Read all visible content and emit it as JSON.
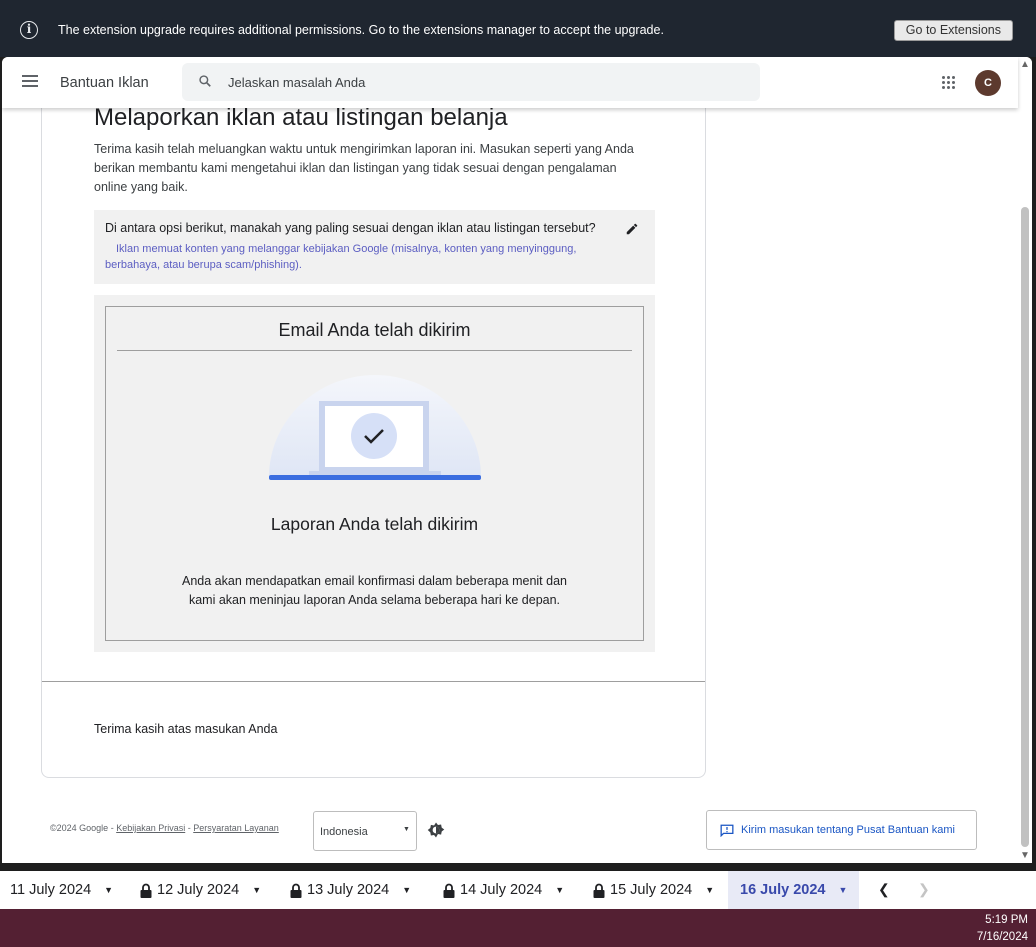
{
  "banner": {
    "message": "The extension upgrade requires additional permissions. Go to the extensions manager to accept the upgrade.",
    "button_label": "Go to Extensions"
  },
  "appbar": {
    "brand": "Bantuan Iklan",
    "search_placeholder": "Jelaskan masalah Anda",
    "avatar_letter": "C"
  },
  "main": {
    "title": "Melaporkan iklan atau listingan belanja",
    "intro": "Terima kasih telah meluangkan waktu untuk mengirimkan laporan ini. Masukan seperti yang Anda berikan membantu kami mengetahui iklan dan listingan yang tidak sesuai dengan pengalaman online yang baik.",
    "question": "Di antara opsi berikut, manakah yang paling sesuai dengan iklan atau listingan tersebut?",
    "answer": "Iklan memuat konten yang melanggar kebijakan Google (misalnya, konten yang menyinggung, berbahaya, atau berupa scam/phishing).",
    "sent_heading": "Email Anda telah dikirim",
    "sent_subheading": "Laporan Anda telah dikirim",
    "sent_body": "Anda akan mendapatkan email konfirmasi dalam beberapa menit dan kami akan meninjau laporan Anda selama beberapa hari ke depan.",
    "thanks": "Terima kasih atas masukan Anda"
  },
  "footer": {
    "copyright": "©2024 Google",
    "sep": " - ",
    "privacy": "Kebijakan Privasi",
    "terms": "Persyaratan Layanan",
    "language": "Indonesia",
    "feedback": "Kirim masukan tentang Pusat Bantuan kami"
  },
  "dates": {
    "tabs": [
      "11 July 2024",
      "12 July 2024",
      "13 July 2024",
      "14 July 2024",
      "15 July 2024",
      "16 July 2024"
    ]
  },
  "taskbar": {
    "time": "5:19 PM",
    "date": "7/16/2024"
  },
  "colors": {
    "banner_bg": "#1f2630",
    "link_blue": "#1a56c4",
    "answer_purple": "#5c5ec2",
    "active_tab": "#3949ab",
    "taskbar": "#542033"
  }
}
